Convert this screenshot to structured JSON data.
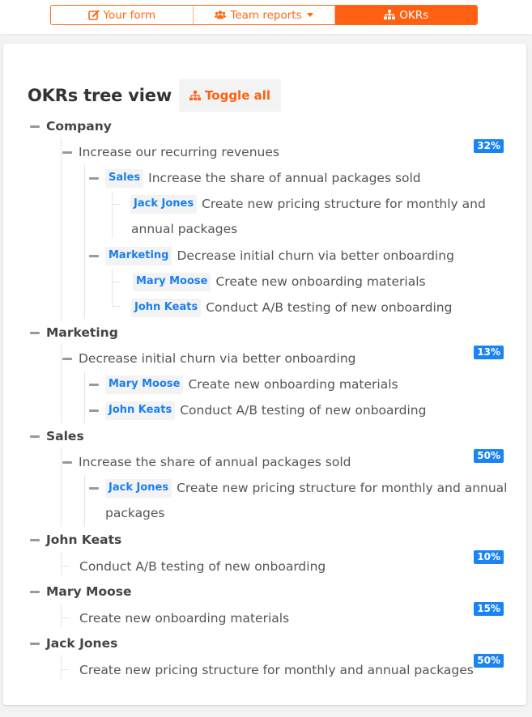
{
  "nav": {
    "items": [
      {
        "label": "Your form",
        "icon": "edit-icon",
        "active": false
      },
      {
        "label": "Team reports",
        "icon": "users-icon",
        "active": false,
        "dropdown": true
      },
      {
        "label": "OKRs",
        "icon": "sitemap-icon",
        "active": true
      }
    ]
  },
  "page": {
    "title": "OKRs tree view",
    "toggle_all_label": "Toggle all",
    "toggle_all_icon": "sitemap-icon"
  },
  "colors": {
    "accent": "#ff6011",
    "tag_blue": "#1a7ff0",
    "badge_blue": "#1a84f5"
  },
  "tree": {
    "company": {
      "label": "Company",
      "objective": {
        "text": "Increase our recurring revenues",
        "progress": "32%",
        "children": [
          {
            "tag": "Sales",
            "text": "Increase the share of annual packages sold",
            "children": [
              {
                "tag": "Jack Jones",
                "text_line1": "Create new pricing structure for monthly and",
                "text_line2": "annual packages"
              }
            ]
          },
          {
            "tag": "Marketing",
            "text": "Decrease initial churn via better onboarding",
            "children": [
              {
                "tag": "Mary Moose",
                "text": "Create new onboarding materials"
              },
              {
                "tag": "John Keats",
                "text": "Conduct A/B testing of new onboarding"
              }
            ]
          }
        ]
      }
    },
    "marketing": {
      "label": "Marketing",
      "objective": {
        "text": "Decrease initial churn via better onboarding",
        "progress": "13%",
        "children": [
          {
            "tag": "Mary Moose",
            "text": "Create new onboarding materials"
          },
          {
            "tag": "John Keats",
            "text": "Conduct A/B testing of new onboarding"
          }
        ]
      }
    },
    "sales": {
      "label": "Sales",
      "objective": {
        "text": "Increase the share of annual packages sold",
        "progress": "50%",
        "children": [
          {
            "tag": "Jack Jones",
            "text_line1": "Create new pricing structure for monthly and annual",
            "text_line2": "packages"
          }
        ]
      }
    },
    "john_keats": {
      "label": "John Keats",
      "objective": {
        "text": "Conduct A/B testing of new onboarding",
        "progress": "10%"
      }
    },
    "mary_moose": {
      "label": "Mary Moose",
      "objective": {
        "text": "Create new onboarding materials",
        "progress": "15%"
      }
    },
    "jack_jones": {
      "label": "Jack Jones",
      "objective": {
        "text": "Create new pricing structure for monthly and annual packages",
        "progress": "50%"
      }
    }
  }
}
